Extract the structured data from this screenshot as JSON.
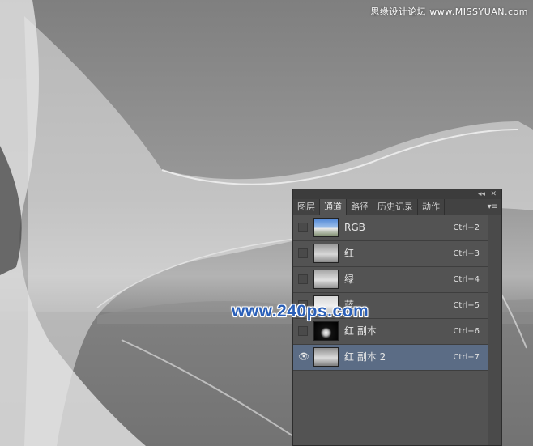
{
  "watermark": {
    "top": "思缘设计论坛 www.MISSYUAN.com",
    "center": "www.240ps.com"
  },
  "panel": {
    "tabs": [
      {
        "label": "图层"
      },
      {
        "label": "通道"
      },
      {
        "label": "路径"
      },
      {
        "label": "历史记录"
      },
      {
        "label": "动作"
      }
    ],
    "active_tab": "通道",
    "collapse_icon": "double-arrow-left-icon",
    "close_icon": "close-icon",
    "menu_icon": "panel-menu-icon",
    "channels": [
      {
        "name": "RGB",
        "shortcut": "Ctrl+2",
        "visible": false,
        "selected": false
      },
      {
        "name": "红",
        "shortcut": "Ctrl+3",
        "visible": false,
        "selected": false
      },
      {
        "name": "绿",
        "shortcut": "Ctrl+4",
        "visible": false,
        "selected": false
      },
      {
        "name": "蓝",
        "shortcut": "Ctrl+5",
        "visible": false,
        "selected": false
      },
      {
        "name": "红 副本",
        "shortcut": "Ctrl+6",
        "visible": false,
        "selected": false
      },
      {
        "name": "红 副本 2",
        "shortcut": "Ctrl+7",
        "visible": true,
        "selected": true
      }
    ]
  },
  "colors": {
    "panel_bg": "#535353",
    "selected_row": "#5b6c85",
    "watermark_blue": "#2a5fb8"
  }
}
